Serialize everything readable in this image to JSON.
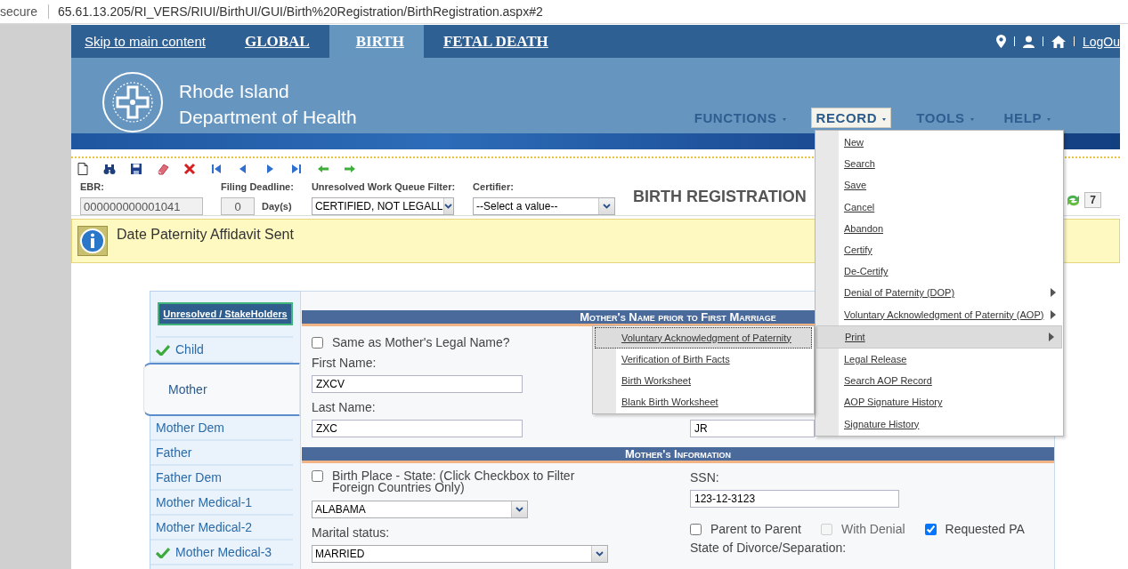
{
  "browser": {
    "security": "secure",
    "url": "65.61.13.205/RI_VERS/RIUI/BirthUI/GUI/Birth%20Registration/BirthRegistration.aspx#2"
  },
  "top_nav": {
    "skip_link": "Skip to main content",
    "tabs": [
      {
        "label": "GLOBAL",
        "selected": false
      },
      {
        "label": "BIRTH",
        "selected": true
      },
      {
        "label": "FETAL DEATH",
        "selected": false
      }
    ],
    "logout": "LogOu"
  },
  "header": {
    "org_line1": "Rhode Island",
    "org_line2": "Department of Health",
    "menus": [
      {
        "label": "FUNCTIONS",
        "selected": false
      },
      {
        "label": "RECORD",
        "selected": true
      },
      {
        "label": "TOOLS",
        "selected": false
      },
      {
        "label": "HELP",
        "selected": false
      }
    ]
  },
  "toolbar": {
    "fields": [
      {
        "kind": "text",
        "label": "EBR:",
        "value": "000000000001041"
      },
      {
        "kind": "days",
        "label": "Filing Deadline:",
        "value": "0",
        "unit": "Day(s)"
      },
      {
        "kind": "select",
        "label": "Unresolved Work Queue Filter:",
        "value": "CERTIFIED, NOT LEGALL"
      },
      {
        "kind": "select",
        "label": "Certifier:",
        "value": "--Select a value--"
      }
    ],
    "title": "BIRTH REGISTRATION",
    "count": "7"
  },
  "info_bar": {
    "message": "Date Paternity Affidavit Sent"
  },
  "sidebar": {
    "button": "Unresolved / StakeHolders",
    "items": [
      {
        "label": "Child",
        "complete": true,
        "selected": false
      },
      {
        "label": "Mother",
        "complete": false,
        "selected": true
      },
      {
        "label": "Mother Dem",
        "complete": false,
        "selected": false
      },
      {
        "label": "Father",
        "complete": false,
        "selected": false
      },
      {
        "label": "Father Dem",
        "complete": false,
        "selected": false
      },
      {
        "label": "Mother Medical-1",
        "complete": false,
        "selected": false
      },
      {
        "label": "Mother Medical-2",
        "complete": false,
        "selected": false
      },
      {
        "label": "Mother Medical-3",
        "complete": true,
        "selected": false
      }
    ]
  },
  "sections": [
    {
      "title": "Mother's Name prior to First Marriage",
      "left": [
        {
          "kind": "checkbox",
          "label": "Same as Mother's Legal Name?",
          "checked": false
        },
        {
          "kind": "text",
          "label": "First Name:",
          "value": "ZXCV"
        },
        {
          "kind": "text",
          "label": "Last Name:",
          "value": "ZXC"
        }
      ],
      "right": [
        {
          "kind": "text",
          "value": "JR"
        }
      ]
    },
    {
      "title": "Mother's Information",
      "left": [
        {
          "kind": "checkbox",
          "label": "Birth Place - State: (Click Checkbox to Filter Foreign Countries Only)",
          "checked": false
        },
        {
          "kind": "select",
          "value": "ALABAMA"
        },
        {
          "kind": "select",
          "label": "Marital status:",
          "value": "MARRIED"
        }
      ],
      "right": [
        {
          "kind": "text",
          "label": "SSN:",
          "value": "123-12-3123"
        },
        {
          "kind": "checkrow",
          "options": [
            {
              "label": "Parent to Parent",
              "checked": false,
              "disabled": false
            },
            {
              "label": "With Denial",
              "checked": false,
              "disabled": true
            },
            {
              "label": "Requested PA",
              "checked": true,
              "disabled": false
            }
          ]
        },
        {
          "kind": "label",
          "label": "State of Divorce/Separation:"
        }
      ]
    }
  ],
  "record_menu": {
    "items": [
      {
        "label": "New",
        "has_submenu": false,
        "selected": false
      },
      {
        "label": "Search",
        "has_submenu": false,
        "selected": false
      },
      {
        "label": "Save",
        "has_submenu": false,
        "selected": false
      },
      {
        "label": "Cancel",
        "has_submenu": false,
        "selected": false
      },
      {
        "label": "Abandon",
        "has_submenu": false,
        "selected": false
      },
      {
        "label": "Certify",
        "has_submenu": false,
        "selected": false
      },
      {
        "label": "De-Certify",
        "has_submenu": false,
        "selected": false
      },
      {
        "label": "Denial of Paternity (DOP)",
        "has_submenu": true,
        "selected": false
      },
      {
        "label": "Voluntary Acknowledgment of Paternity (AOP)",
        "has_submenu": true,
        "selected": false
      },
      {
        "label": "Print",
        "has_submenu": true,
        "selected": true,
        "children": [
          {
            "label": "Voluntary Acknowledgment of Paternity",
            "selected": true
          },
          {
            "label": "Verification of Birth Facts",
            "selected": false
          },
          {
            "label": "Birth Worksheet",
            "selected": false
          },
          {
            "label": "Blank Birth Worksheet",
            "selected": false
          }
        ]
      },
      {
        "label": "Legal Release",
        "has_submenu": false,
        "selected": false
      },
      {
        "label": "Search AOP Record",
        "has_submenu": false,
        "selected": false
      },
      {
        "label": "AOP Signature History",
        "has_submenu": false,
        "selected": false
      },
      {
        "label": "Signature History",
        "has_submenu": false,
        "selected": false
      }
    ]
  }
}
